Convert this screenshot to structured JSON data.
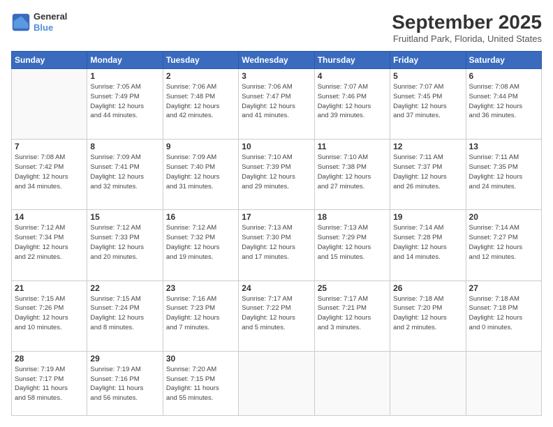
{
  "header": {
    "logo_general": "General",
    "logo_blue": "Blue",
    "title": "September 2025",
    "subtitle": "Fruitland Park, Florida, United States"
  },
  "weekdays": [
    "Sunday",
    "Monday",
    "Tuesday",
    "Wednesday",
    "Thursday",
    "Friday",
    "Saturday"
  ],
  "weeks": [
    [
      {
        "day": "",
        "info": ""
      },
      {
        "day": "1",
        "info": "Sunrise: 7:05 AM\nSunset: 7:49 PM\nDaylight: 12 hours\nand 44 minutes."
      },
      {
        "day": "2",
        "info": "Sunrise: 7:06 AM\nSunset: 7:48 PM\nDaylight: 12 hours\nand 42 minutes."
      },
      {
        "day": "3",
        "info": "Sunrise: 7:06 AM\nSunset: 7:47 PM\nDaylight: 12 hours\nand 41 minutes."
      },
      {
        "day": "4",
        "info": "Sunrise: 7:07 AM\nSunset: 7:46 PM\nDaylight: 12 hours\nand 39 minutes."
      },
      {
        "day": "5",
        "info": "Sunrise: 7:07 AM\nSunset: 7:45 PM\nDaylight: 12 hours\nand 37 minutes."
      },
      {
        "day": "6",
        "info": "Sunrise: 7:08 AM\nSunset: 7:44 PM\nDaylight: 12 hours\nand 36 minutes."
      }
    ],
    [
      {
        "day": "7",
        "info": "Sunrise: 7:08 AM\nSunset: 7:42 PM\nDaylight: 12 hours\nand 34 minutes."
      },
      {
        "day": "8",
        "info": "Sunrise: 7:09 AM\nSunset: 7:41 PM\nDaylight: 12 hours\nand 32 minutes."
      },
      {
        "day": "9",
        "info": "Sunrise: 7:09 AM\nSunset: 7:40 PM\nDaylight: 12 hours\nand 31 minutes."
      },
      {
        "day": "10",
        "info": "Sunrise: 7:10 AM\nSunset: 7:39 PM\nDaylight: 12 hours\nand 29 minutes."
      },
      {
        "day": "11",
        "info": "Sunrise: 7:10 AM\nSunset: 7:38 PM\nDaylight: 12 hours\nand 27 minutes."
      },
      {
        "day": "12",
        "info": "Sunrise: 7:11 AM\nSunset: 7:37 PM\nDaylight: 12 hours\nand 26 minutes."
      },
      {
        "day": "13",
        "info": "Sunrise: 7:11 AM\nSunset: 7:35 PM\nDaylight: 12 hours\nand 24 minutes."
      }
    ],
    [
      {
        "day": "14",
        "info": "Sunrise: 7:12 AM\nSunset: 7:34 PM\nDaylight: 12 hours\nand 22 minutes."
      },
      {
        "day": "15",
        "info": "Sunrise: 7:12 AM\nSunset: 7:33 PM\nDaylight: 12 hours\nand 20 minutes."
      },
      {
        "day": "16",
        "info": "Sunrise: 7:12 AM\nSunset: 7:32 PM\nDaylight: 12 hours\nand 19 minutes."
      },
      {
        "day": "17",
        "info": "Sunrise: 7:13 AM\nSunset: 7:30 PM\nDaylight: 12 hours\nand 17 minutes."
      },
      {
        "day": "18",
        "info": "Sunrise: 7:13 AM\nSunset: 7:29 PM\nDaylight: 12 hours\nand 15 minutes."
      },
      {
        "day": "19",
        "info": "Sunrise: 7:14 AM\nSunset: 7:28 PM\nDaylight: 12 hours\nand 14 minutes."
      },
      {
        "day": "20",
        "info": "Sunrise: 7:14 AM\nSunset: 7:27 PM\nDaylight: 12 hours\nand 12 minutes."
      }
    ],
    [
      {
        "day": "21",
        "info": "Sunrise: 7:15 AM\nSunset: 7:26 PM\nDaylight: 12 hours\nand 10 minutes."
      },
      {
        "day": "22",
        "info": "Sunrise: 7:15 AM\nSunset: 7:24 PM\nDaylight: 12 hours\nand 8 minutes."
      },
      {
        "day": "23",
        "info": "Sunrise: 7:16 AM\nSunset: 7:23 PM\nDaylight: 12 hours\nand 7 minutes."
      },
      {
        "day": "24",
        "info": "Sunrise: 7:17 AM\nSunset: 7:22 PM\nDaylight: 12 hours\nand 5 minutes."
      },
      {
        "day": "25",
        "info": "Sunrise: 7:17 AM\nSunset: 7:21 PM\nDaylight: 12 hours\nand 3 minutes."
      },
      {
        "day": "26",
        "info": "Sunrise: 7:18 AM\nSunset: 7:20 PM\nDaylight: 12 hours\nand 2 minutes."
      },
      {
        "day": "27",
        "info": "Sunrise: 7:18 AM\nSunset: 7:18 PM\nDaylight: 12 hours\nand 0 minutes."
      }
    ],
    [
      {
        "day": "28",
        "info": "Sunrise: 7:19 AM\nSunset: 7:17 PM\nDaylight: 11 hours\nand 58 minutes."
      },
      {
        "day": "29",
        "info": "Sunrise: 7:19 AM\nSunset: 7:16 PM\nDaylight: 11 hours\nand 56 minutes."
      },
      {
        "day": "30",
        "info": "Sunrise: 7:20 AM\nSunset: 7:15 PM\nDaylight: 11 hours\nand 55 minutes."
      },
      {
        "day": "",
        "info": ""
      },
      {
        "day": "",
        "info": ""
      },
      {
        "day": "",
        "info": ""
      },
      {
        "day": "",
        "info": ""
      }
    ]
  ]
}
